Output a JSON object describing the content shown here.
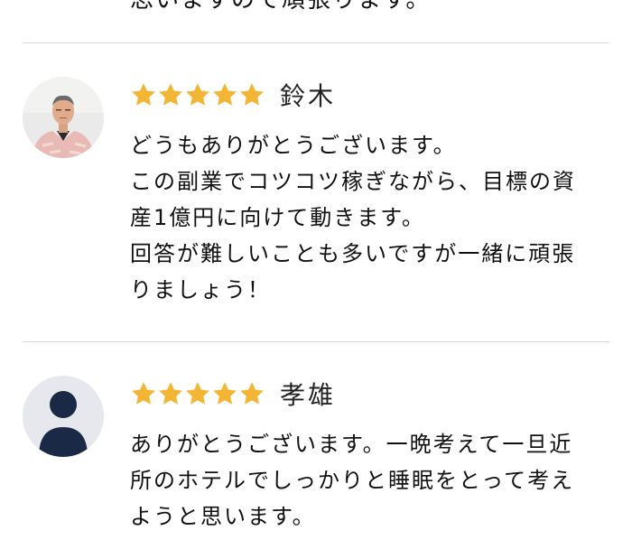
{
  "previous_review": {
    "cut_text": "思いますので頑張ります。"
  },
  "reviews": [
    {
      "name": "鈴木",
      "rating": 5,
      "avatar": "photo-avatar",
      "lines": [
        "どうもありがとうございます。",
        "この副業でコツコツ稼ぎながら、目標の資",
        "産1億円に向けて動きます。",
        "回答が難しいことも多いですが一緒に頑張",
        "りましょう！"
      ]
    },
    {
      "name": "孝雄",
      "rating": 5,
      "avatar": "default-user-avatar",
      "lines": [
        "ありがとうございます。一晩考えて一旦近",
        "所のホテルでしっかりと睡眠をとって考え",
        "ようと思います。"
      ]
    }
  ],
  "colors": {
    "star": "#f2b634",
    "divider": "#d9d9d9",
    "avatar_bg": "#e6e8ee",
    "avatar_figure": "#1a2945"
  }
}
